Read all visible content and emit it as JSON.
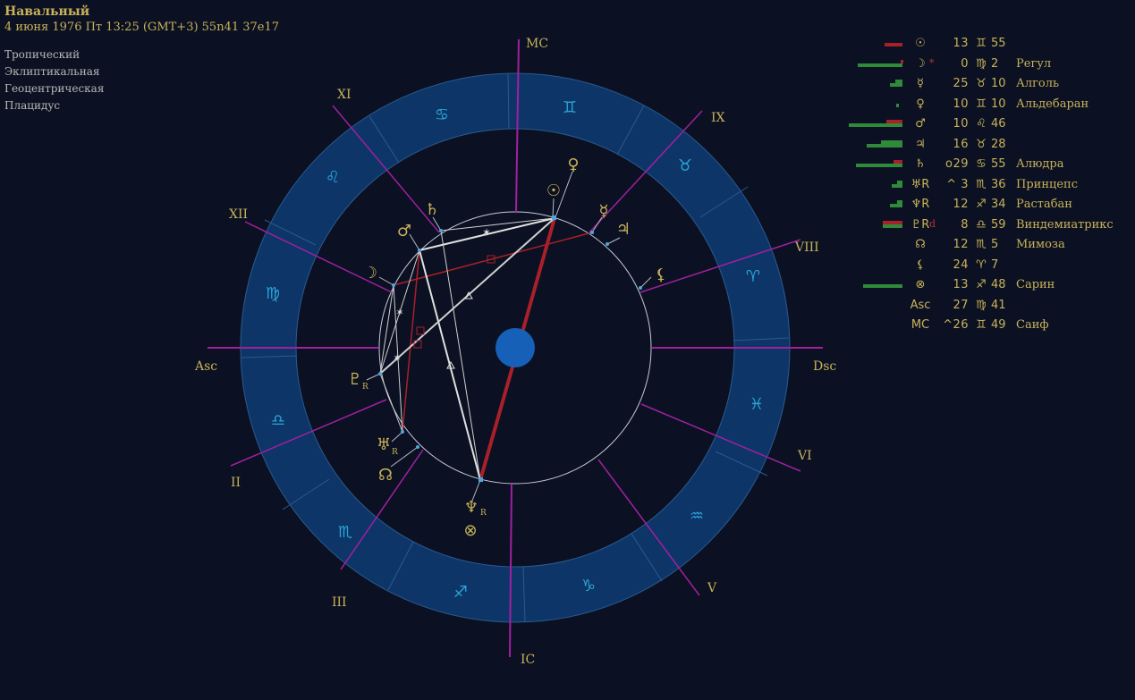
{
  "header": {
    "name": "Навальный",
    "details": "4 июня 1976  Пт  13:25 (GMT+3) 55n41  37e17"
  },
  "settings": [
    "Тропический",
    "Эклиптикальная",
    "Геоцентрическая",
    "Плацидус"
  ],
  "angles": {
    "mc": "MC",
    "ic": "IC",
    "asc": "Asc",
    "dsc": "Dsc"
  },
  "houses": {
    "ii": "II",
    "iii": "III",
    "v": "V",
    "vi": "VI",
    "viii": "VIII",
    "ix": "IX",
    "xi": "XI",
    "xii": "XII"
  },
  "signs": [
    {
      "name": "cancer",
      "glyph": "♋"
    },
    {
      "name": "gemini",
      "glyph": "♊"
    },
    {
      "name": "taurus",
      "glyph": "♉"
    },
    {
      "name": "aries",
      "glyph": "♈"
    },
    {
      "name": "pisces",
      "glyph": "♓"
    },
    {
      "name": "aquarius",
      "glyph": "♒"
    },
    {
      "name": "capricorn",
      "glyph": "♑"
    },
    {
      "name": "sagittarius",
      "glyph": "♐"
    },
    {
      "name": "scorpio",
      "glyph": "♏"
    },
    {
      "name": "libra",
      "glyph": "♎"
    },
    {
      "name": "virgo",
      "glyph": "♍"
    },
    {
      "name": "leo",
      "glyph": "♌"
    }
  ],
  "chart_planets": [
    {
      "name": "venus",
      "glyph": "♀"
    },
    {
      "name": "sun",
      "glyph": "☉"
    },
    {
      "name": "mercury",
      "glyph": "☿"
    },
    {
      "name": "jupiter",
      "glyph": "♃"
    },
    {
      "name": "lilith",
      "glyph": "⚸"
    },
    {
      "name": "saturn",
      "glyph": "♄"
    },
    {
      "name": "mars",
      "glyph": "♂"
    },
    {
      "name": "moon",
      "glyph": "☽"
    },
    {
      "name": "pluto",
      "glyph": "♇"
    },
    {
      "name": "uranus",
      "glyph": "♅"
    },
    {
      "name": "node",
      "glyph": "☊"
    },
    {
      "name": "neptune",
      "glyph": "♆"
    },
    {
      "name": "fortune",
      "glyph": "⊗"
    }
  ],
  "retro_mark": "R",
  "planet_table": [
    {
      "glyph": "☉",
      "flag": "",
      "pos": "13",
      "sign": "♊",
      "min": "55",
      "star": ""
    },
    {
      "glyph": "☽",
      "flag": "*",
      "pos": "0",
      "sign": "♍",
      "min": "2",
      "star": "Регул"
    },
    {
      "glyph": "☿",
      "flag": "",
      "pos": "25",
      "sign": "♉",
      "min": "10",
      "star": "Алголь"
    },
    {
      "glyph": "♀",
      "flag": "",
      "pos": "10",
      "sign": "♊",
      "min": "10",
      "star": "Альдебаран"
    },
    {
      "glyph": "♂",
      "flag": "",
      "pos": "10",
      "sign": "♌",
      "min": "46",
      "star": ""
    },
    {
      "glyph": "♃",
      "flag": "",
      "pos": "16",
      "sign": "♉",
      "min": "28",
      "star": ""
    },
    {
      "glyph": "♄",
      "flag": "",
      "pos": "o29",
      "sign": "♋",
      "min": "55",
      "star": "Алюдра"
    },
    {
      "glyph": "♅R",
      "flag": "",
      "pos": "^ 3",
      "sign": "♏",
      "min": "36",
      "star": "Принцепс"
    },
    {
      "glyph": "♆R",
      "flag": "",
      "pos": "12",
      "sign": "♐",
      "min": "34",
      "star": "Растабан"
    },
    {
      "glyph": "♇R",
      "flag": "d",
      "pos": "8",
      "sign": "♎",
      "min": "59",
      "star": "Виндемиатрикс"
    },
    {
      "glyph": "☊",
      "flag": "",
      "pos": "12",
      "sign": "♏",
      "min": "5",
      "star": "Мимоза"
    },
    {
      "glyph": "⚸",
      "flag": "",
      "pos": "24",
      "sign": "♈",
      "min": "7",
      "star": ""
    },
    {
      "glyph": "⊗",
      "flag": "",
      "pos": "13",
      "sign": "♐",
      "min": "48",
      "star": "Сарин"
    },
    {
      "glyph": "Asc",
      "flag": "",
      "pos": "27",
      "sign": "♍",
      "min": "41",
      "star": ""
    },
    {
      "glyph": "MC",
      "flag": "",
      "pos": "^26",
      "sign": "♊",
      "min": "49",
      "star": "Саиф"
    }
  ],
  "colors": {
    "background": "#0b1122",
    "zodiac_band": "#0e3567",
    "house_line": "#a020a0",
    "text": "#c9b25a",
    "sign_glyph": "#29a5d8"
  }
}
